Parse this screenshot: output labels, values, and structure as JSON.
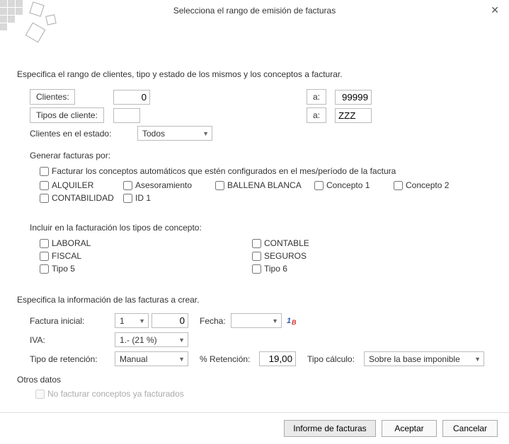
{
  "window": {
    "title": "Selecciona el rango de emisión de facturas"
  },
  "intro": "Especifica el rango de clientes, tipo y estado de los mismos y los conceptos a facturar.",
  "clientes": {
    "label": "Clientes:",
    "from": "0",
    "a_label": "a:",
    "to": "99999"
  },
  "tipos_cliente": {
    "label": "Tipos de cliente:",
    "from": "",
    "a_label": "a:",
    "to": "ZZZ"
  },
  "estado": {
    "label": "Clientes en el estado:",
    "value": "Todos"
  },
  "generar": {
    "label": "Generar facturas por:",
    "auto": "Facturar los conceptos automáticos que estén configurados en el mes/período de la factura",
    "opts": [
      "ALQUILER",
      "Asesoramiento",
      "BALLENA BLANCA",
      "Concepto 1",
      "Concepto 2",
      "CONTABILIDAD",
      "ID 1"
    ]
  },
  "incluir": {
    "label": "Incluir en la facturación los tipos de concepto:",
    "left": [
      "LABORAL",
      "FISCAL",
      "Tipo 5"
    ],
    "right": [
      "CONTABLE",
      "SEGUROS",
      "Tipo 6"
    ]
  },
  "crear": {
    "label": "Especifica la información de las facturas a crear.",
    "factura_inicial_label": "Factura inicial:",
    "factura_inicial_serie": "1",
    "factura_inicial_num": "0",
    "fecha_label": "Fecha:",
    "fecha_value": "",
    "iva_label": "IVA:",
    "iva_value": "1.- (21 %)",
    "ret_tipo_label": "Tipo de retención:",
    "ret_tipo_value": "Manual",
    "ret_pct_label": "% Retención:",
    "ret_pct_value": "19,00",
    "calc_label": "Tipo cálculo:",
    "calc_value": "Sobre la base imponible"
  },
  "otros": {
    "label": "Otros datos",
    "no_fact": "No facturar conceptos ya facturados"
  },
  "buttons": {
    "informe": "Informe de facturas",
    "aceptar": "Aceptar",
    "cancelar": "Cancelar"
  }
}
